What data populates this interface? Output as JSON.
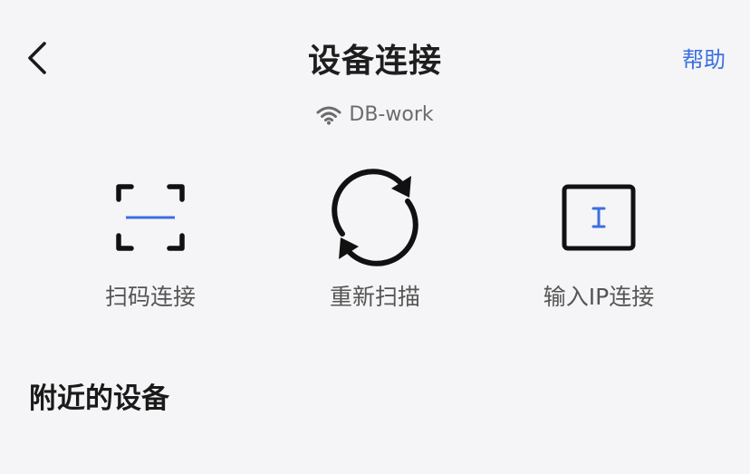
{
  "header": {
    "title": "设备连接",
    "help_label": "帮助"
  },
  "network": {
    "icon": "wifi-icon",
    "ssid": "DB-work"
  },
  "actions": [
    {
      "icon": "scan-icon",
      "label": "扫码连接"
    },
    {
      "icon": "refresh-icon",
      "label": "重新扫描"
    },
    {
      "icon": "text-input-icon",
      "label": "输入IP连接"
    }
  ],
  "nearby": {
    "title": "附近的设备"
  },
  "colors": {
    "background": "#f5f5f7",
    "accent": "#3c6fe0",
    "icon_stroke": "#111111"
  }
}
